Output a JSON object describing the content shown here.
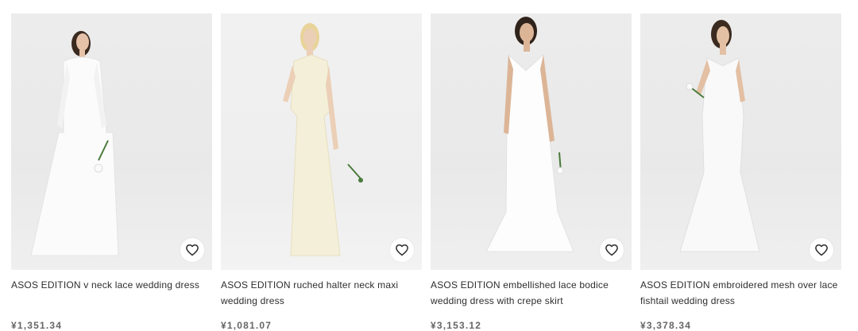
{
  "products": [
    {
      "title": "ASOS EDITION v neck lace wedding dress",
      "price": "¥1,351.34",
      "icon": "heart-outline-icon"
    },
    {
      "title": "ASOS EDITION ruched halter neck maxi wedding dress",
      "price": "¥1,081.07",
      "icon": "heart-outline-icon"
    },
    {
      "title": "ASOS EDITION embellished lace bodice wedding dress with crepe skirt",
      "price": "¥3,153.12",
      "icon": "heart-outline-icon"
    },
    {
      "title": "ASOS EDITION embroidered mesh over lace fishtail wedding dress",
      "price": "¥3,378.34",
      "icon": "heart-outline-icon"
    }
  ],
  "colors": {
    "title_text": "#2d2d2d",
    "price_text": "#666666",
    "image_background": "#ececec",
    "save_button": "#ffffff"
  }
}
